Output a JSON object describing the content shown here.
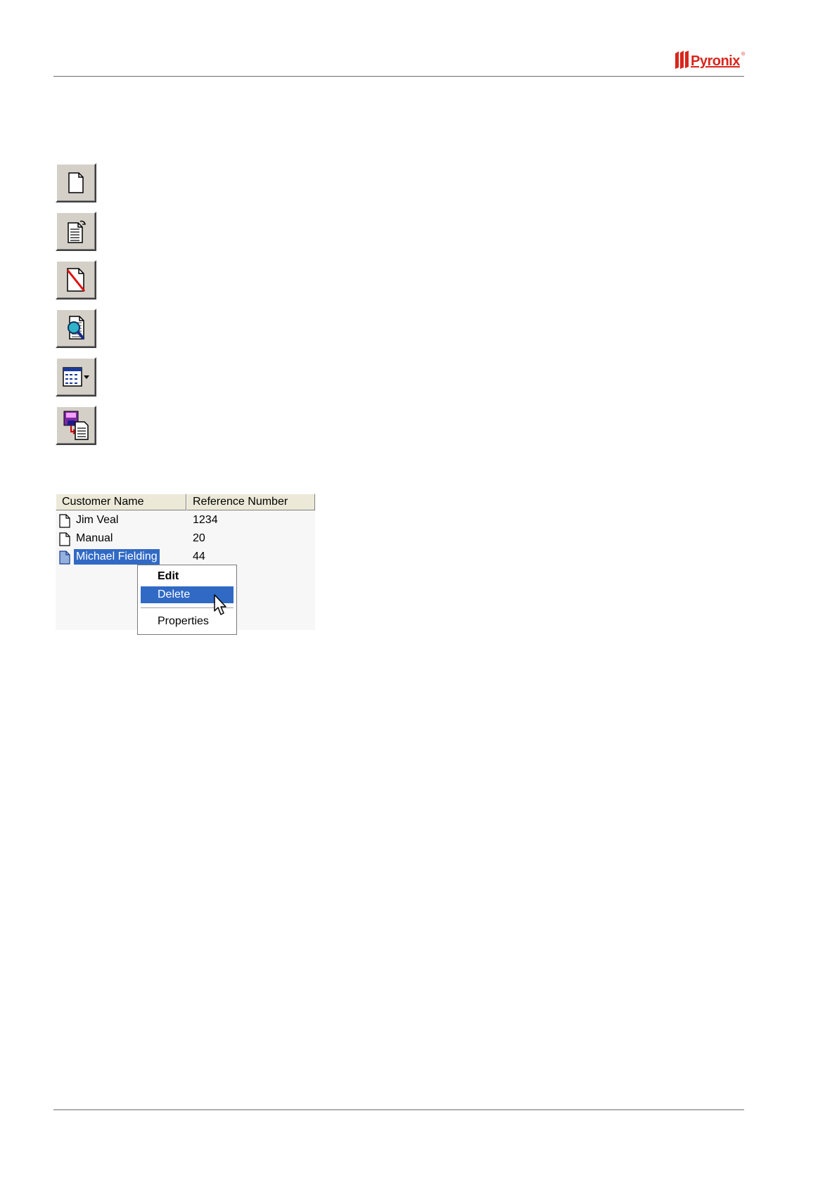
{
  "brand": {
    "logo_text": "Pyronix",
    "logo_reg": "®",
    "accent_color": "#d8261c"
  },
  "toolbar": {
    "buttons": [
      {
        "icon": "new-document-icon"
      },
      {
        "icon": "edit-document-icon"
      },
      {
        "icon": "delete-document-icon"
      },
      {
        "icon": "search-document-icon"
      },
      {
        "icon": "view-options-icon"
      },
      {
        "icon": "save-document-icon"
      }
    ]
  },
  "customer_list": {
    "columns": [
      "Customer Name",
      "Reference Number"
    ],
    "rows": [
      {
        "name": "Jim Veal",
        "reference": "1234",
        "selected": false
      },
      {
        "name": "Manual",
        "reference": "20",
        "selected": false
      },
      {
        "name": "Michael Fielding",
        "reference": "44",
        "selected": true
      }
    ],
    "selection_color": "#316ac5"
  },
  "context_menu": {
    "items": [
      {
        "label": "Edit",
        "default": true
      },
      {
        "label": "Delete",
        "highlighted": true
      },
      {
        "label": "Properties"
      }
    ]
  }
}
